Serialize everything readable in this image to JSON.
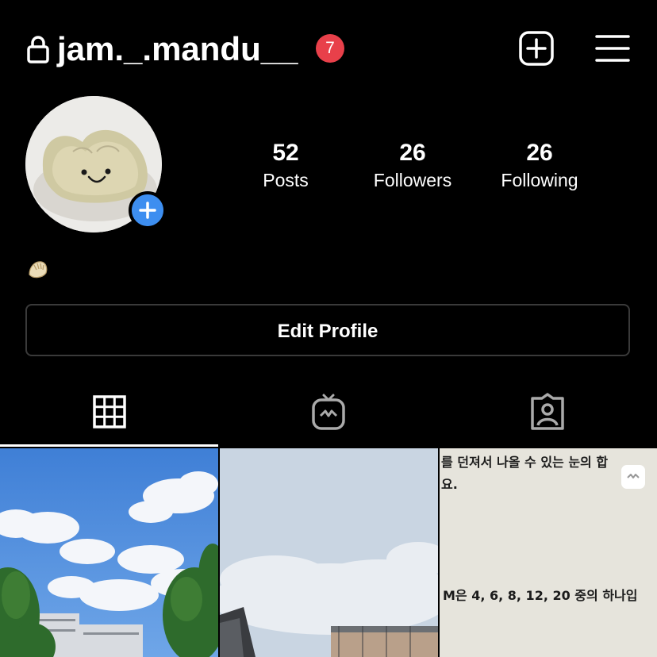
{
  "header": {
    "username": "jam._.mandu__",
    "notification_count": "7",
    "icons": [
      "lock-icon",
      "add-post-icon",
      "menu-icon"
    ]
  },
  "profile": {
    "avatar_alt": "dumpling",
    "stats": [
      {
        "value": "52",
        "label": "Posts"
      },
      {
        "value": "26",
        "label": "Followers"
      },
      {
        "value": "26",
        "label": "Following"
      }
    ],
    "bio_emoji": "dumpling-emoji",
    "edit_button": "Edit Profile"
  },
  "tabs": [
    {
      "name": "grid",
      "icon": "grid-icon",
      "active": true
    },
    {
      "name": "igtv",
      "icon": "igtv-icon",
      "active": false
    },
    {
      "name": "tagged",
      "icon": "tagged-icon",
      "active": false
    }
  ],
  "posts": [
    {
      "type": "photo",
      "subject": "blue-sky-trees"
    },
    {
      "type": "photo",
      "subject": "cloudy-sky-building"
    },
    {
      "type": "photo",
      "subject": "korean-math-text",
      "lines": [
        "를 던져서 나올 수 있는 눈의 합",
        "요.",
        "M은 4, 6, 8, 12, 20 중의 하나입"
      ]
    }
  ],
  "colors": {
    "background": "#000000",
    "badge": "#e8404a",
    "accent": "#3d8ef0",
    "border": "#3a3a3a"
  }
}
